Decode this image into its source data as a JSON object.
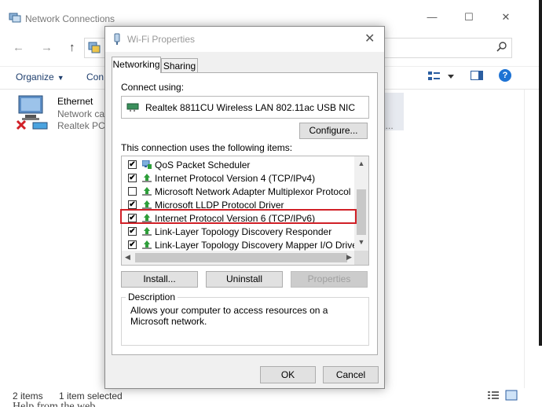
{
  "explorer": {
    "title": "Network Connections",
    "window_controls": {
      "minimize": "—",
      "maximize": "☐",
      "close": "✕"
    },
    "nav": {
      "back": "←",
      "forward": "→",
      "up": "↑"
    },
    "search_icon": "search-icon",
    "organize_label": "Organize",
    "organize_caret": "▼",
    "second_command": "Con",
    "help_label": "?",
    "items": [
      {
        "name": "Ethernet",
        "line1": "Network ca",
        "line2": "Realtek PCI"
      },
      {
        "name": "",
        "line2": "2..."
      }
    ],
    "status": {
      "count": "2 items",
      "selected": "1 item selected"
    },
    "bottom_text": "Help from the web"
  },
  "dialog": {
    "title": "Wi-Fi Properties",
    "close": "✕",
    "tabs": [
      {
        "label": "Networking",
        "active": true
      },
      {
        "label": "Sharing",
        "active": false
      }
    ],
    "connect_using_label": "Connect using:",
    "adapter_name": "Realtek 8811CU Wireless LAN 802.11ac USB NIC",
    "configure_label": "Configure...",
    "items_label": "This connection uses the following items:",
    "items": [
      {
        "label": "QoS Packet Scheduler",
        "checked": "✔",
        "icon": "qos-network-icon"
      },
      {
        "label": "Internet Protocol Version 4 (TCP/IPv4)",
        "checked": "✔",
        "icon": "protocol-icon"
      },
      {
        "label": "Microsoft Network Adapter Multiplexor Protocol",
        "checked": "",
        "icon": "protocol-icon"
      },
      {
        "label": "Microsoft LLDP Protocol Driver",
        "checked": "✔",
        "icon": "protocol-icon"
      },
      {
        "label": "Internet Protocol Version 6 (TCP/IPv6)",
        "checked": "✔",
        "icon": "protocol-icon",
        "highlighted": true
      },
      {
        "label": "Link-Layer Topology Discovery Responder",
        "checked": "✔",
        "icon": "protocol-icon"
      },
      {
        "label": "Link-Layer Topology Discovery Mapper I/O Driver",
        "checked": "✔",
        "icon": "protocol-icon"
      }
    ],
    "scroll_up": "▲",
    "scroll_down": "▼",
    "scroll_left": "◀",
    "scroll_right": "▶",
    "install_label": "Install...",
    "uninstall_label": "Uninstall",
    "properties_label": "Properties",
    "description_legend": "Description",
    "description_text": "Allows your computer to access resources on a Microsoft network.",
    "ok_label": "OK",
    "cancel_label": "Cancel"
  },
  "colors": {
    "highlight_border": "#d12027",
    "protocol_icon_green": "#2e9e3a",
    "help_blue": "#1e73d4"
  }
}
